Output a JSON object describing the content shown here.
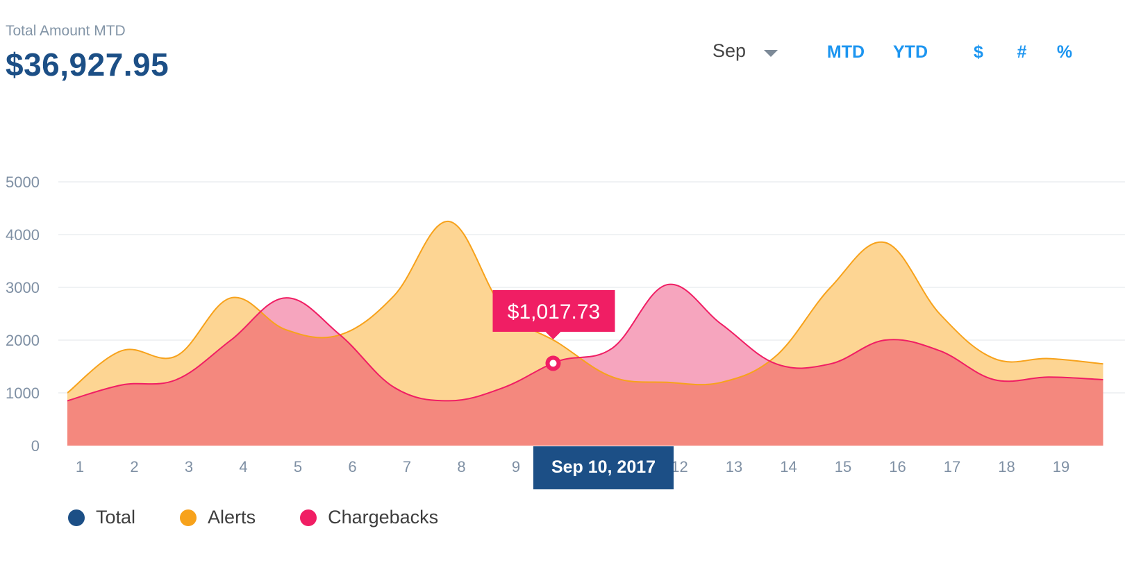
{
  "header": {
    "title": "Total Amount MTD",
    "amount": "$36,927.95"
  },
  "controls": {
    "month": "Sep",
    "period_options": [
      "MTD",
      "YTD"
    ],
    "period_selected": "MTD",
    "unit_options": [
      "$",
      "#",
      "%"
    ],
    "unit_selected": "#"
  },
  "tooltip": {
    "value": "$1,017.73",
    "date_label": "Sep 10, 2017"
  },
  "colors": {
    "alerts": "#f7a21b",
    "alerts_fill": "#fdd593",
    "chargebacks": "#f01e64",
    "chargebacks_fill": "#f5a0bb",
    "overlap_fill": "#f4887e",
    "total": "#1c4f86",
    "axis_text": "#7f90a4"
  },
  "chart_data": {
    "type": "area",
    "x": [
      1,
      2,
      3,
      4,
      5,
      6,
      7,
      8,
      9,
      10,
      11,
      12,
      13,
      14,
      15,
      16,
      17,
      18,
      19,
      20
    ],
    "x_tick_labels": [
      "1",
      "2",
      "3",
      "4",
      "5",
      "6",
      "7",
      "8",
      "9",
      "10",
      "11",
      "12",
      "13",
      "14",
      "15",
      "16",
      "17",
      "18",
      "19"
    ],
    "ylim": [
      0,
      5000
    ],
    "y_ticks": [
      0,
      1000,
      2000,
      3000,
      4000,
      5000
    ],
    "grid": true,
    "series": [
      {
        "name": "Alerts",
        "values": [
          1000,
          1800,
          1700,
          2800,
          2200,
          2100,
          2850,
          4250,
          2600,
          1950,
          1300,
          1200,
          1200,
          1700,
          3000,
          3850,
          2500,
          1650,
          1650,
          1550
        ]
      },
      {
        "name": "Chargebacks",
        "values": [
          850,
          1150,
          1250,
          2000,
          2800,
          2100,
          1100,
          850,
          1100,
          1600,
          1850,
          3050,
          2300,
          1550,
          1550,
          2000,
          1800,
          1250,
          1300,
          1250
        ]
      }
    ],
    "legend": [
      "Total",
      "Alerts",
      "Chargebacks"
    ],
    "legend_position": "bottom-left",
    "highlight": {
      "series": "Chargebacks",
      "x": 10
    }
  }
}
